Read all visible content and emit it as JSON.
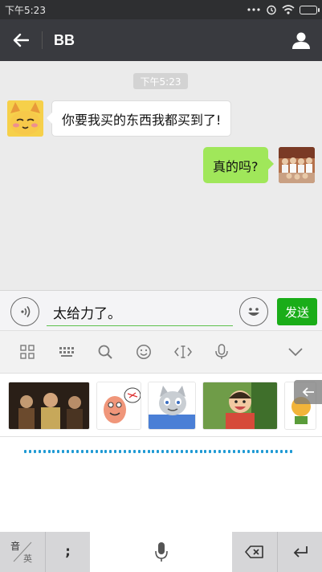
{
  "status_bar": {
    "time": "下午5:23"
  },
  "header": {
    "title": "BB"
  },
  "chat": {
    "time_badge": "下午5:23",
    "messages": [
      {
        "side": "incoming",
        "text": "你要我买的东西我都买到了!"
      },
      {
        "side": "outgoing",
        "text": "真的吗?"
      }
    ]
  },
  "input": {
    "value": "太给力了。",
    "send_label": "发送"
  },
  "keyboard": {
    "lang_top": "音",
    "lang_bottom": "英",
    "punct": ";"
  }
}
